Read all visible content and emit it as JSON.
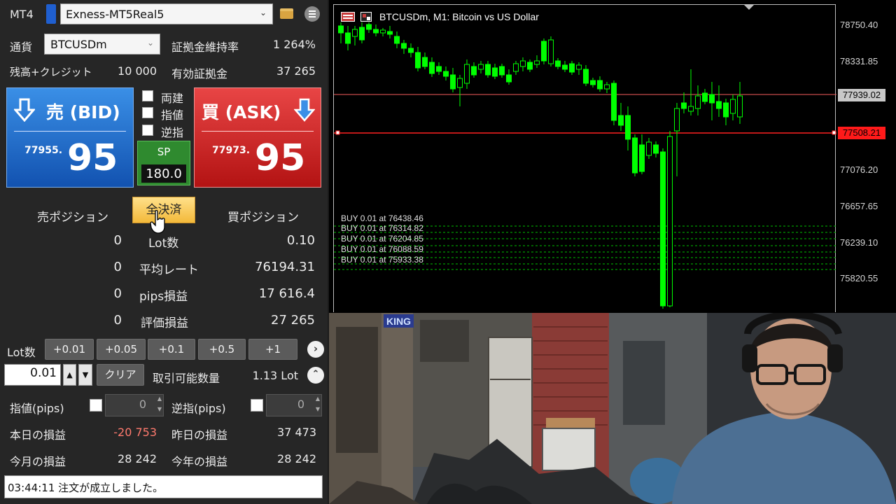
{
  "panel": {
    "platform": "MT4",
    "account": "Exness-MT5Real5",
    "currency_label": "通貨",
    "symbol": "BTCUSDm",
    "margin_ratio_label": "証拠金維持率",
    "margin_ratio": "1 264%",
    "balance_label": "残高+クレジット",
    "balance": "10 000",
    "equity_label": "有効証拠金",
    "equity": "37 265",
    "sell_label": "売 (BID)",
    "bid_small": "77955.",
    "bid_big": "95",
    "buy_label": "買 (ASK)",
    "ask_small": "77973.",
    "ask_big": "95",
    "opt_hedge": "両建",
    "opt_limit": "指値",
    "opt_stop": "逆指",
    "sp_label": "SP",
    "sp_value": "180.0",
    "sell_pos_label": "売ポジション",
    "close_all_label": "全決済",
    "buy_pos_label": "買ポジション",
    "rows": [
      {
        "left": "0",
        "label": "Lot数",
        "right": "0.10"
      },
      {
        "left": "0",
        "label": "平均レート",
        "right": "76194.31"
      },
      {
        "left": "0",
        "label": "pips損益",
        "right": "17 616.4"
      },
      {
        "left": "0",
        "label": "評価損益",
        "right": "27 265"
      }
    ],
    "lot_label": "Lot数",
    "lot_buttons": [
      "+0.01",
      "+0.05",
      "+0.1",
      "+0.5",
      "+1"
    ],
    "lot_value": "0.01",
    "clear_label": "クリア",
    "tradable_label": "取引可能数量",
    "tradable_value": "1.13 Lot",
    "limit_pips_label": "指値(pips)",
    "limit_pips_value": "0",
    "stop_pips_label": "逆指(pips)",
    "stop_pips_value": "0",
    "today_pl_label": "本日の損益",
    "today_pl": "-20 753",
    "yesterday_pl_label": "昨日の損益",
    "yesterday_pl": "37 473",
    "month_pl_label": "今月の損益",
    "month_pl": "28 242",
    "year_pl_label": "今年の損益",
    "year_pl": "28 242",
    "status": "03:44:11 注文が成立しました。"
  },
  "chart": {
    "title": "BTCUSDm, M1:  Bitcoin vs US Dollar",
    "price_labels": [
      "78750.40",
      "78331.85",
      "77076.20",
      "76657.65",
      "76239.10",
      "75820.55"
    ],
    "ask_tag": "77939.02",
    "bid_tag": "77508.21",
    "orders": [
      "BUY 0.01 at 76438.46",
      "BUY 0.01 at 76314.82",
      "BUY 0.01 at 76204.85",
      "BUY 0.01 at 76088.59",
      "BUY 0.01 at 75933.38"
    ],
    "colors": {
      "candle": "#00ff00",
      "ask_line": "#c8c8c8",
      "bid_line": "#ff2020",
      "order_line": "#00c000"
    }
  },
  "webcam": {
    "sign": "KING"
  }
}
